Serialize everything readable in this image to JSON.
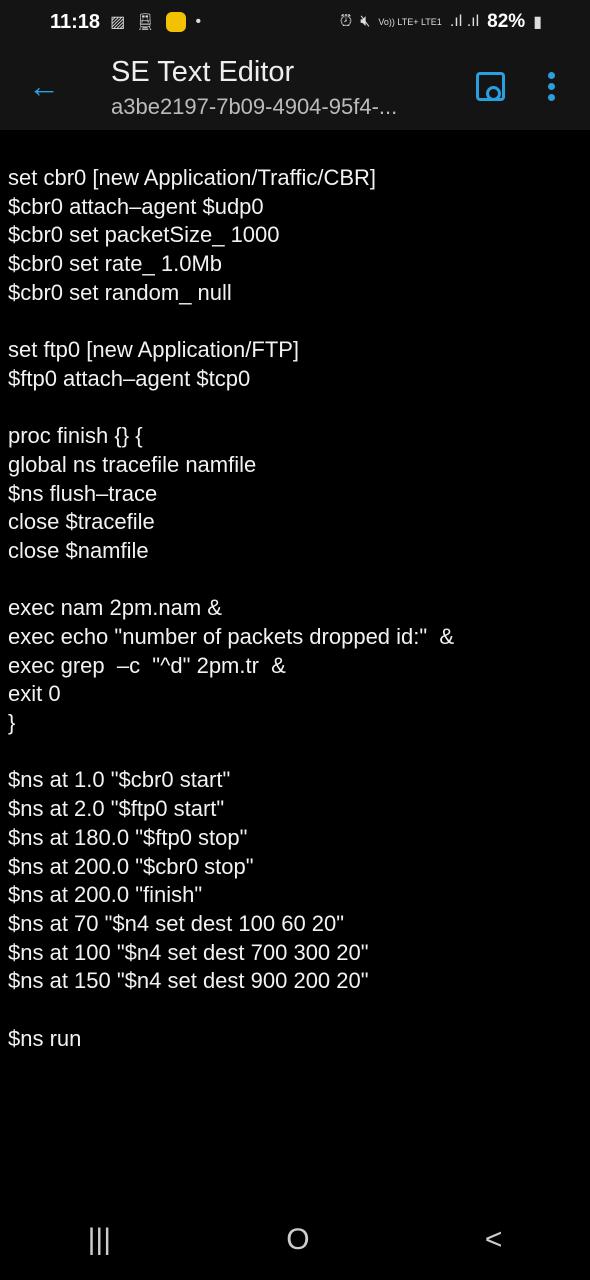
{
  "status_bar": {
    "time": "11:18",
    "network": "Vo)) LTE+ LTE1",
    "battery": "82%"
  },
  "app_bar": {
    "title": "SE Text Editor",
    "subtitle": "a3be2197-7b09-4904-95f4-..."
  },
  "icons": {
    "back": "arrow-left-icon",
    "save": "floppy-disk-icon",
    "more": "more-vert-icon"
  },
  "accent_color": "#2a9fe0",
  "editor": {
    "lines": [
      "set cbr0 [new Application/Traffic/CBR]",
      "$cbr0 attach–agent $udp0",
      "$cbr0 set packetSize_ 1000",
      "$cbr0 set rate_ 1.0Mb",
      "$cbr0 set random_ null",
      "",
      "set ftp0 [new Application/FTP]",
      "$ftp0 attach–agent $tcp0",
      "",
      "proc finish {} {",
      "global ns tracefile namfile",
      "$ns flush–trace",
      "close $tracefile",
      "close $namfile",
      "",
      "exec nam 2pm.nam &",
      "exec echo \"number of packets dropped id:\"  &",
      "exec grep  –c  \"^d\" 2pm.tr  &",
      "exit 0",
      "}",
      "",
      "$ns at 1.0 \"$cbr0 start\"",
      "$ns at 2.0 \"$ftp0 start\"",
      "$ns at 180.0 \"$ftp0 stop\"",
      "$ns at 200.0 \"$cbr0 stop\"",
      "$ns at 200.0 \"finish\"",
      "$ns at 70 \"$n4 set dest 100 60 20\"",
      "$ns at 100 \"$n4 set dest 700 300 20\"",
      "$ns at 150 \"$n4 set dest 900 200 20\"",
      "",
      "$ns run"
    ]
  },
  "nav": {
    "recents": "|||",
    "home": "O",
    "back": "<"
  }
}
